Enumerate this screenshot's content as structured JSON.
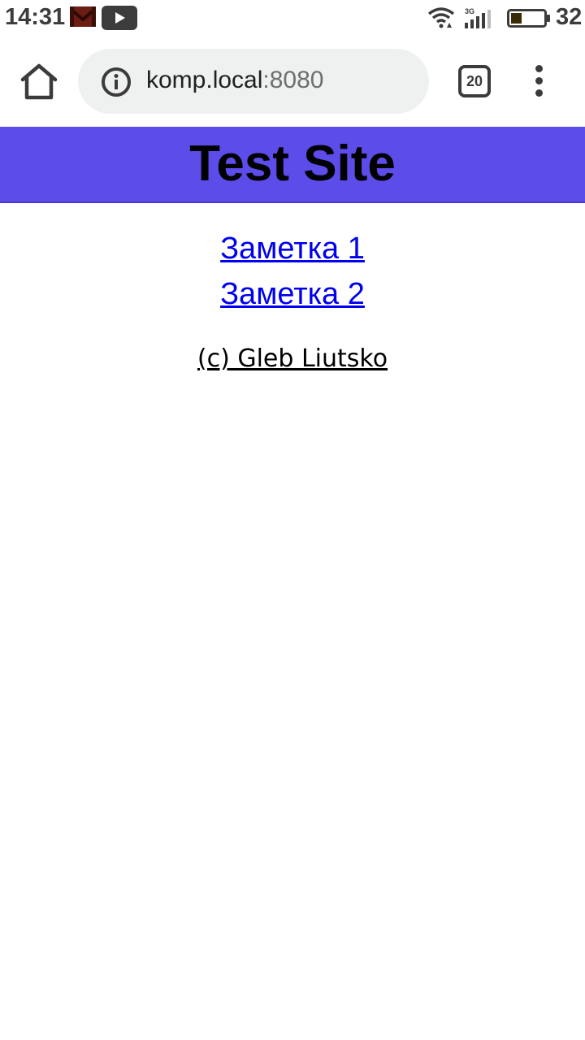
{
  "status_bar": {
    "time": "14:31",
    "battery_level": "32",
    "battery_fraction": 0.32,
    "network_type": "3G",
    "icons": [
      "gmail-icon",
      "youtube-icon",
      "wifi-icon",
      "signal-icon",
      "battery-icon"
    ]
  },
  "browser": {
    "url_host": "komp.local",
    "url_port": ":8080",
    "tab_count": "20",
    "icons": [
      "home-icon",
      "info-icon",
      "tabs-icon",
      "more-vert-icon"
    ]
  },
  "page": {
    "title": "Test Site",
    "header_color": "#5c4ce9",
    "links": [
      {
        "label": "Заметка 1"
      },
      {
        "label": "Заметка 2"
      }
    ],
    "footer": "(c) Gleb Liutsko"
  }
}
